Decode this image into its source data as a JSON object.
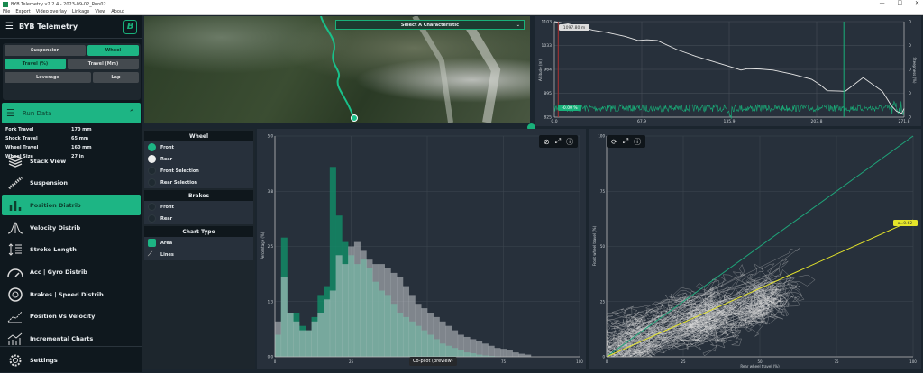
{
  "window": {
    "title": "BYB Telemetry v2.2.4 - 2023-09-02_Run02",
    "controls": [
      "—",
      "☐",
      "✕"
    ]
  },
  "menu": [
    "File",
    "Export",
    "Video overlay",
    "Linkage",
    "View",
    "About"
  ],
  "sidebar": {
    "app_name": "BYB Telemetry",
    "logo": "B",
    "toggles": {
      "suspension": "Suspension",
      "wheel": "Wheel",
      "travel_pct": "Travel (%)",
      "travel_mm": "Travel (Mm)",
      "leverage": "Leverage",
      "lap": "Lap"
    },
    "run_data": {
      "title": "Run Data",
      "rows": [
        {
          "k": "Fork Travel",
          "v": "170 mm"
        },
        {
          "k": "Shock Travel",
          "v": "65 mm"
        },
        {
          "k": "Wheel Travel",
          "v": "160 mm"
        },
        {
          "k": "Wheel Size",
          "v": "27 in"
        }
      ]
    },
    "nav": [
      {
        "label": "Stack View",
        "icon": "layers-icon"
      },
      {
        "label": "Suspension",
        "icon": "shock-icon"
      },
      {
        "label": "Position Distrib",
        "icon": "bar-chart-icon",
        "active": true
      },
      {
        "label": "Velocity Distrib",
        "icon": "bell-curve-icon"
      },
      {
        "label": "Stroke Length",
        "icon": "stroke-icon"
      },
      {
        "label": "Acc | Gyro Distrib",
        "icon": "gauge-icon"
      },
      {
        "label": "Brakes | Speed Distrib",
        "icon": "brake-disc-icon"
      },
      {
        "label": "Position Vs Velocity",
        "icon": "scatter-icon"
      },
      {
        "label": "Incremental Charts",
        "icon": "incremental-icon"
      }
    ],
    "settings": "Settings"
  },
  "map": {
    "select_placeholder": "Select A Characteristic"
  },
  "altitude_chart": {
    "ylabel": "Altitude (m)",
    "y2label": "Steepness (%)",
    "cursor_altitude": "1097.80 m",
    "cursor_steepness": "-0.00 %",
    "accent": "#19b07a"
  },
  "options": {
    "wheel_header": "Wheel",
    "wheel": [
      "Front",
      "Rear",
      "Front Selection",
      "Rear Selection"
    ],
    "brakes_header": "Brakes",
    "brakes": [
      "Front",
      "Rear"
    ],
    "chart_type_header": "Chart Type",
    "chart_types": [
      "Area",
      "Lines"
    ]
  },
  "tooltip": "Co-pilot (preview)",
  "colors": {
    "accent": "#1db584",
    "front": "#138a66",
    "rear": "#c8ccd0",
    "identity_line": "#1fa57a",
    "fit_line": "#e5e52a"
  },
  "chart_data": [
    {
      "type": "line",
      "xlabel": "",
      "ylabel": "Altitude (m)",
      "y2label": "Steepness (%)",
      "xlim": [
        0,
        271.8
      ],
      "ylim": [
        825,
        1103
      ],
      "x_ticks": [
        "0.0",
        "67.9",
        "135.9",
        "203.8",
        "271.8"
      ],
      "y_ticks": [
        "1103",
        "1033",
        "964",
        "895",
        "825"
      ],
      "y2_ticks": [
        "0",
        "0",
        "0",
        "0",
        "0"
      ],
      "series": [
        {
          "name": "Altitude",
          "x": [
            0,
            10,
            20,
            30,
            40,
            55,
            65,
            72,
            80,
            95,
            110,
            125,
            140,
            145,
            150,
            160,
            170,
            185,
            200,
            207,
            212,
            222,
            226,
            240,
            255,
            262,
            266,
            270,
            271.8
          ],
          "y": [
            1103,
            1097,
            1088,
            1078,
            1072,
            1060,
            1048,
            1050,
            1048,
            1022,
            1002,
            985,
            968,
            962,
            966,
            965,
            962,
            950,
            935,
            918,
            902,
            901,
            900,
            940,
            900,
            858,
            842,
            836,
            850
          ]
        }
      ],
      "markers": [
        {
          "x": 3,
          "color": "#b03030"
        },
        {
          "x": 225,
          "color": "#19b07a"
        }
      ]
    },
    {
      "type": "area",
      "ylabel": "Percentage (%)",
      "xlim": [
        0,
        100
      ],
      "ylim": [
        0,
        5
      ],
      "x_ticks": [
        "0",
        "25",
        "50",
        "75",
        "100"
      ],
      "y_ticks": [
        "5.0",
        "3.8",
        "2.5",
        "1.3",
        "0.0"
      ],
      "bin_width": 2,
      "series": [
        {
          "name": "Front",
          "values": [
            0.5,
            2.7,
            1.0,
            1.0,
            0.7,
            0.6,
            0.9,
            1.4,
            1.6,
            4.3,
            3.2,
            2.6,
            2.3,
            2.1,
            2.2,
            2.0,
            1.7,
            1.5,
            1.4,
            1.2,
            1.0,
            0.9,
            0.8,
            0.7,
            0.6,
            0.5,
            0.4,
            0.3,
            0.25,
            0.2,
            0.15,
            0.1,
            0.08,
            0.05,
            0.03,
            0.02,
            0.01,
            0,
            0,
            0,
            0,
            0,
            0,
            0,
            0,
            0,
            0,
            0,
            0,
            0
          ]
        },
        {
          "name": "Rear",
          "values": [
            0.8,
            1.8,
            1.0,
            0.8,
            0.6,
            0.6,
            0.8,
            1.0,
            1.3,
            1.5,
            2.3,
            2.1,
            2.5,
            2.6,
            2.4,
            2.2,
            2.1,
            2.1,
            2.0,
            1.9,
            1.8,
            1.6,
            1.4,
            1.2,
            1.1,
            1.0,
            0.9,
            0.8,
            0.7,
            0.6,
            0.5,
            0.45,
            0.4,
            0.35,
            0.3,
            0.25,
            0.2,
            0.18,
            0.15,
            0.1,
            0.07,
            0.05,
            0,
            0,
            0,
            0,
            0,
            0,
            0,
            0
          ]
        }
      ]
    },
    {
      "type": "scatter",
      "xlabel": "Rear wheel travel (%)",
      "ylabel": "Front wheel travel (%)",
      "xlim": [
        0,
        100
      ],
      "ylim": [
        0,
        100
      ],
      "x_ticks": [
        "0",
        "25",
        "50",
        "75",
        "100"
      ],
      "y_ticks": [
        "100",
        "75",
        "50",
        "25",
        "0"
      ],
      "lines": [
        {
          "slope": 1,
          "color": "#1fa57a"
        },
        {
          "slope": 0.62,
          "color": "#e5e52a",
          "label": "a=0.62"
        }
      ]
    }
  ]
}
